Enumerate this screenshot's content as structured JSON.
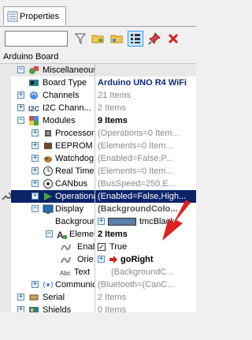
{
  "tab": {
    "label": "Properties"
  },
  "search": {
    "value": "",
    "placeholder": ""
  },
  "toolbar": {
    "buttons": [
      {
        "icon": "filter-icon"
      },
      {
        "icon": "folder-icon"
      },
      {
        "icon": "folder-expand-icon"
      },
      {
        "icon": "categorized-icon"
      },
      {
        "icon": "pin-icon"
      },
      {
        "icon": "delete-icon"
      }
    ]
  },
  "root": {
    "label": "Arduino Board"
  },
  "rows": [
    {
      "name": "Miscellaneous",
      "value": ""
    },
    {
      "name": "Board Type",
      "value": "Arduino UNO R4 WiFi"
    },
    {
      "name": "Channels",
      "value": "21 Items"
    },
    {
      "name": "I2C Chann...",
      "value": "2 Items"
    },
    {
      "name": "Modules",
      "value": "9 Items"
    },
    {
      "name": "Processor",
      "value": "(Operations=0 Item..."
    },
    {
      "name": "EEPROM",
      "value": "(Elements=0 Item..."
    },
    {
      "name": "Watchdog...",
      "value": "(Enabled=False,P..."
    },
    {
      "name": "Real Time...",
      "value": "(Elements=0 Item..."
    },
    {
      "name": "CANbus",
      "value": "(BusSpeed=250,E..."
    },
    {
      "name": "Operational...",
      "value": "(Enabled=False,High..."
    },
    {
      "name": "Display",
      "value": "(BackgroundColo..."
    },
    {
      "name": "Backgroun...",
      "value": "tmcBlack"
    },
    {
      "name": "Elements",
      "value": "2 Items"
    },
    {
      "name": "Enabled",
      "value": "True"
    },
    {
      "name": "Orie...",
      "value": "goRight"
    },
    {
      "name": "Text",
      "value": "(BackgroundC..."
    },
    {
      "name": "Communic...",
      "value": "(Bluetooth=(CanC..."
    },
    {
      "name": "Serial",
      "value": "2 Items"
    },
    {
      "name": "Shields",
      "value": "0 Items"
    }
  ],
  "colors": {
    "selection": "#0a246a",
    "category_bg": "#e8e8e8",
    "value_emphasis": "#0b2a7a",
    "arrow": "#e02020"
  }
}
